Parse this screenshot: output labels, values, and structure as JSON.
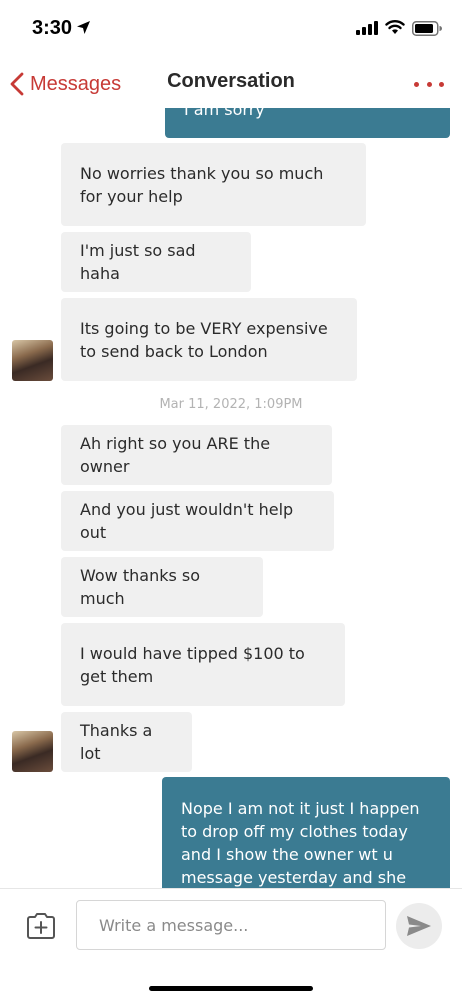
{
  "status_bar": {
    "time": "3:30"
  },
  "nav": {
    "back_label": "Messages",
    "title": "Conversation"
  },
  "messages": [
    {
      "dir": "out",
      "text": "I am sorry"
    },
    {
      "dir": "in",
      "text": "No worries thank you so much for your help"
    },
    {
      "dir": "in",
      "text": "I'm just so sad haha"
    },
    {
      "dir": "in",
      "text": "Its going to be VERY expensive to send back to London"
    },
    {
      "dir": "in",
      "text": "Ah right so you ARE the owner"
    },
    {
      "dir": "in",
      "text": "And you just wouldn't help out"
    },
    {
      "dir": "in",
      "text": "Wow thanks so much"
    },
    {
      "dir": "in",
      "text": "I would have tipped $100 to get them"
    },
    {
      "dir": "in",
      "text": "Thanks a lot"
    },
    {
      "dir": "out",
      "text": "Nope I am not it just I happen to drop off my clothes today and I show the owner wt u message yesterday and she told me u"
    }
  ],
  "timestamp": "Mar 11, 2022, 1:09PM",
  "composer": {
    "placeholder": "Write a message..."
  },
  "colors": {
    "accent": "#c73a36",
    "outgoing_bubble": "#3b7b92",
    "incoming_bubble": "#f0f0f0"
  },
  "icons": [
    "location-arrow-icon",
    "signal-icon",
    "wifi-icon",
    "battery-icon",
    "chevron-left-icon",
    "more-dots-icon",
    "attach-icon",
    "send-icon"
  ]
}
